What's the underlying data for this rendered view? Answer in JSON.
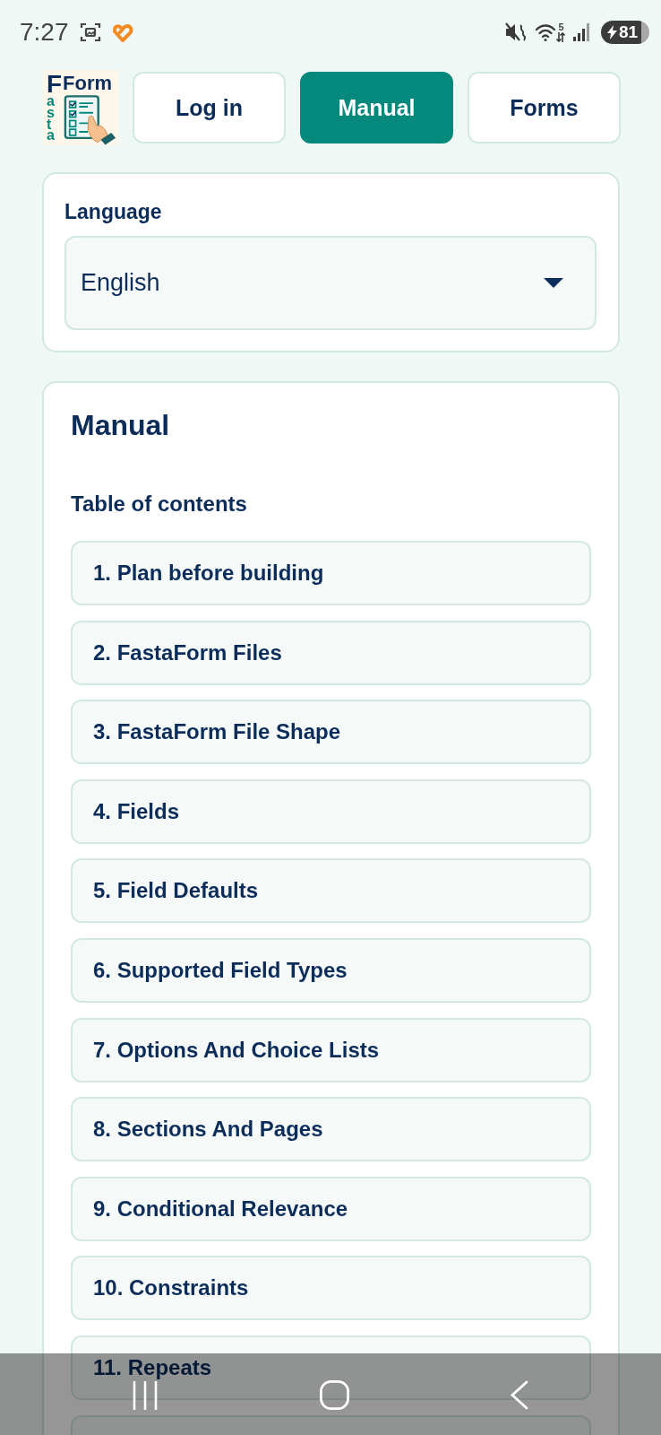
{
  "status_bar": {
    "time": "7:27",
    "wifi_band": "5",
    "battery": "81"
  },
  "logo": {
    "initial": "F",
    "title": "Form",
    "vertical": "asta"
  },
  "nav": {
    "buttons": [
      {
        "label": "Log in",
        "selected": false
      },
      {
        "label": "Manual",
        "selected": true
      },
      {
        "label": "Forms",
        "selected": false
      }
    ]
  },
  "language": {
    "label": "Language",
    "value": "English"
  },
  "manual": {
    "title": "Manual",
    "toc_title": "Table of contents",
    "items": [
      "1. Plan before building",
      "2. FastaForm Files",
      "3. FastaForm File Shape",
      "4. Fields",
      "5. Field Defaults",
      "6. Supported Field Types",
      "7. Options And Choice Lists",
      "8. Sections And Pages",
      "9. Conditional Relevance",
      "10. Constraints",
      "11. Repeats"
    ],
    "more_below": true
  }
}
